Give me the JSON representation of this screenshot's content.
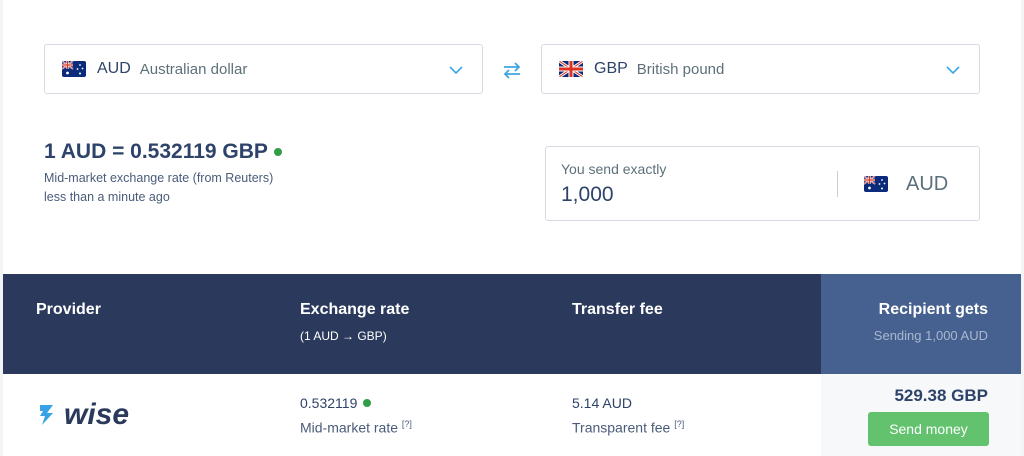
{
  "from_currency": {
    "code": "AUD",
    "name": "Australian dollar",
    "flag_icon": "australia-flag-icon"
  },
  "to_currency": {
    "code": "GBP",
    "name": "British pound",
    "flag_icon": "uk-flag-icon"
  },
  "rate": {
    "headline": "1 AUD = 0.532119 GBP",
    "source": "Mid-market exchange rate (from Reuters)",
    "updated": "less than a minute ago"
  },
  "amount": {
    "label": "You send exactly",
    "value": "1,000",
    "currency": "AUD"
  },
  "table": {
    "headers": {
      "provider": "Provider",
      "exchange_rate": "Exchange rate",
      "exchange_rate_sub": "(1 AUD → GBP)",
      "transfer_fee": "Transfer fee",
      "recipient_gets": "Recipient gets",
      "recipient_sub": "Sending 1,000 AUD"
    },
    "rows": [
      {
        "provider": "wise",
        "rate": "0.532119",
        "rate_label": "Mid-market rate",
        "rate_help": "[?]",
        "fee": "5.14 AUD",
        "fee_label": "Transparent fee",
        "fee_help": "[?]",
        "recipient": "529.38 GBP",
        "button": "Send money"
      }
    ]
  },
  "colors": {
    "header_dark": "#2b3a5c",
    "header_recipient": "#46618f",
    "accent_blue": "#00b9ff",
    "live_green": "#2f9e44",
    "button_green": "#62c26d"
  }
}
